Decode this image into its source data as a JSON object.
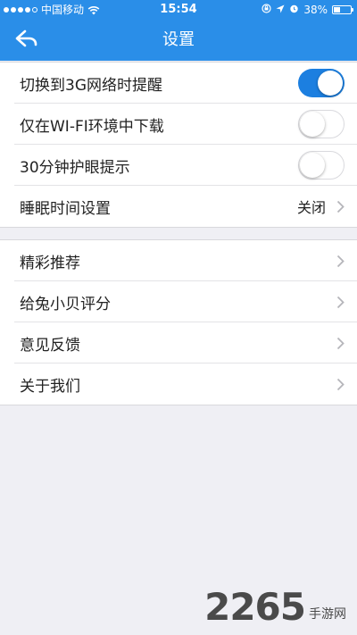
{
  "status_bar": {
    "carrier": "中国移动",
    "time": "15:54",
    "battery": "38%",
    "battery_level": 0.38
  },
  "header": {
    "title": "设置",
    "accent_color": "#2a8ee8"
  },
  "settings_groups": [
    {
      "items": [
        {
          "label": "切换到3G网络时提醒",
          "type": "toggle",
          "on": true
        },
        {
          "label": "仅在WI-FI环境中下载",
          "type": "toggle",
          "on": false
        },
        {
          "label": "30分钟护眼提示",
          "type": "toggle",
          "on": false
        },
        {
          "label": "睡眠时间设置",
          "type": "link",
          "value": "关闭"
        }
      ]
    },
    {
      "items": [
        {
          "label": "精彩推荐",
          "type": "link"
        },
        {
          "label": "给兔小贝评分",
          "type": "link"
        },
        {
          "label": "意见反馈",
          "type": "link"
        },
        {
          "label": "关于我们",
          "type": "link"
        }
      ]
    }
  ],
  "watermark": {
    "number": "2265",
    "text": "手游网"
  }
}
